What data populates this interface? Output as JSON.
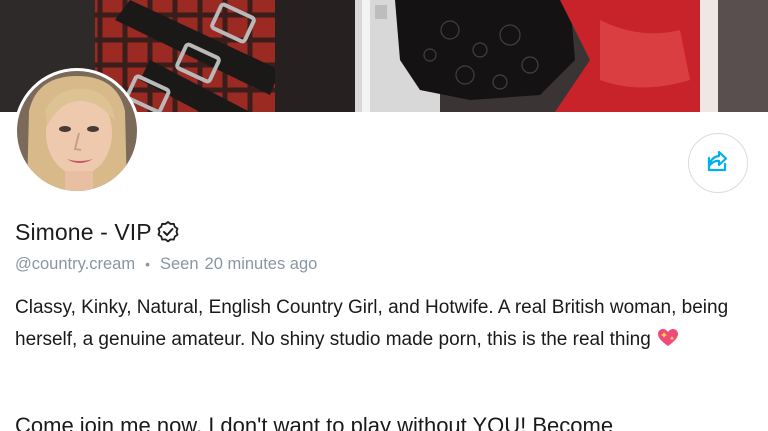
{
  "profile": {
    "display_name": "Simone - VIP",
    "handle": "@country.cream",
    "seen_label": "Seen",
    "seen_time": "20 minutes ago",
    "meta_separator": "•",
    "bio": "Classy, Kinky, Natural, English Country Girl, and Hotwife. A real British woman, being herself, a genuine amateur. No shiny studio made porn, this is the real thing",
    "bio_next_line": "Come join me now, I don't want to play without YOU! Become"
  },
  "icons": {
    "share": "share-icon",
    "verified": "verified-badge-icon",
    "bio_emoji": "sparkling-heart-emoji"
  },
  "colors": {
    "accent": "#00aff0",
    "muted_text": "#8a96a3",
    "border": "#d6dde3"
  }
}
